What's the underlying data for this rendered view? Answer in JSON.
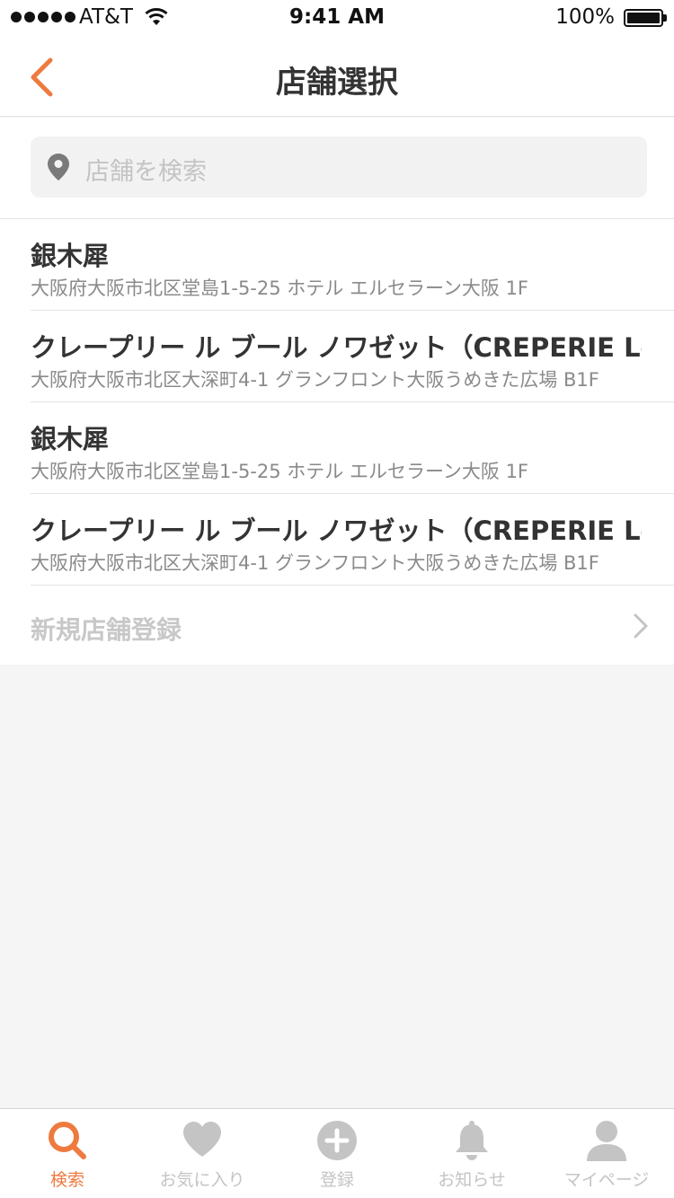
{
  "status_bar": {
    "carrier": "AT&T",
    "time": "9:41 AM",
    "battery": "100%"
  },
  "nav": {
    "title": "店舗選択",
    "back_icon": "chevron-left-icon",
    "accent_color": "#ee7a3f"
  },
  "search": {
    "placeholder": "店舗を検索",
    "icon": "location-pin-icon"
  },
  "shops": [
    {
      "name": "銀木犀",
      "address": "大阪府大阪市北区堂島1-5-25 ホテル エルセラーン大阪 1F"
    },
    {
      "name": "クレープリー ル ブール ノワゼット（CREPERIE Le...",
      "address": "大阪府大阪市北区大深町4-1 グランフロント大阪うめきた広場 B1F"
    },
    {
      "name": "銀木犀",
      "address": "大阪府大阪市北区堂島1-5-25 ホテル エルセラーン大阪 1F"
    },
    {
      "name": "クレープリー ル ブール ノワゼット（CREPERIE Le...",
      "address": "大阪府大阪市北区大深町4-1 グランフロント大阪うめきた広場 B1F"
    }
  ],
  "register": {
    "label": "新規店舗登録"
  },
  "tabs": [
    {
      "label": "検索",
      "icon": "search-icon",
      "active": true
    },
    {
      "label": "お気に入り",
      "icon": "heart-icon",
      "active": false
    },
    {
      "label": "登録",
      "icon": "plus-circle-icon",
      "active": false
    },
    {
      "label": "お知らせ",
      "icon": "bell-icon",
      "active": false
    },
    {
      "label": "マイページ",
      "icon": "user-icon",
      "active": false
    }
  ]
}
